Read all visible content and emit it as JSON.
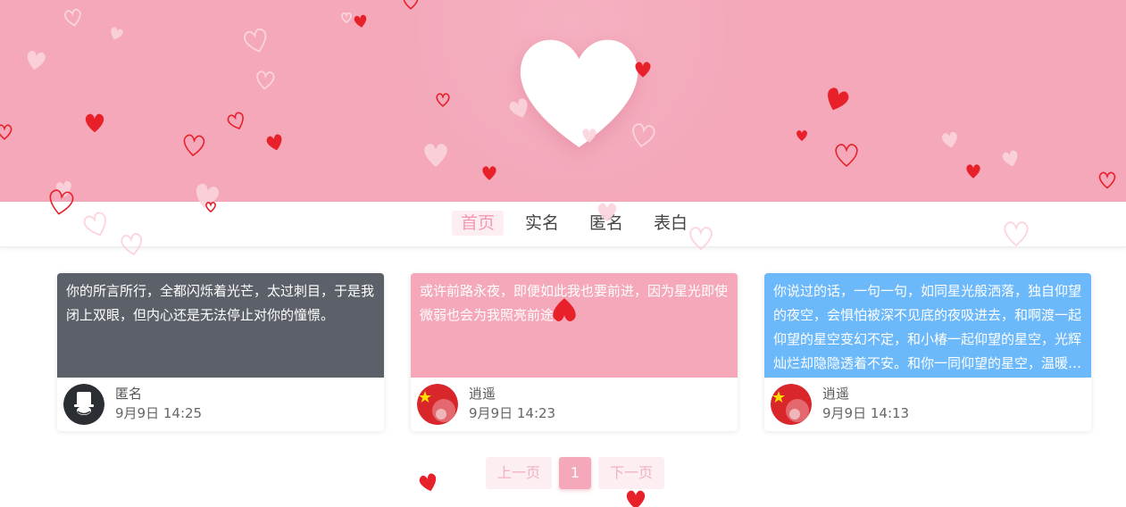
{
  "nav": {
    "items": [
      {
        "label": "首页",
        "active": true
      },
      {
        "label": "实名",
        "active": false
      },
      {
        "label": "匿名",
        "active": false
      },
      {
        "label": "表白",
        "active": false
      }
    ]
  },
  "posts": [
    {
      "content": "你的所言所行，全都闪烁着光芒，太过刺目，于是我闭上双眼，但内心还是无法停止对你的憧憬。",
      "bg_color": "#5c6069",
      "author": "匿名",
      "time": "9月9日 14:25",
      "avatar_icon": "anonymous-avatar-icon"
    },
    {
      "content": "或许前路永夜，即便如此我也要前进，因为星光即使微弱也会为我照亮前途。",
      "bg_color": "#f4a8ba",
      "author": "逍遥",
      "time": "9月9日 14:23",
      "avatar_icon": "flag-avatar-icon"
    },
    {
      "content": "你说过的话，一句一句，如同星光般洒落，独自仰望的夜空，会惧怕被深不见底的夜吸进去，和啊渡一起仰望的星空变幻不定，和小椿一起仰望的星空，光辉灿烂却隐隐透着不安。和你一同仰望的星空，温暖而明亮。",
      "bg_color": "#6bb8fb",
      "author": "逍遥",
      "time": "9月9日 14:13",
      "avatar_icon": "flag-avatar-icon"
    }
  ],
  "pagination": {
    "prev_label": "上一页",
    "current_page": "1",
    "next_label": "下一页"
  },
  "colors": {
    "banner": "#f4a8ba",
    "accent": "#f39ab0",
    "heart_red": "#e8202a",
    "heart_pale": "#fbd4dc"
  },
  "icons": {
    "banner_heart": "heart-icon",
    "floating": "heart-icon"
  }
}
